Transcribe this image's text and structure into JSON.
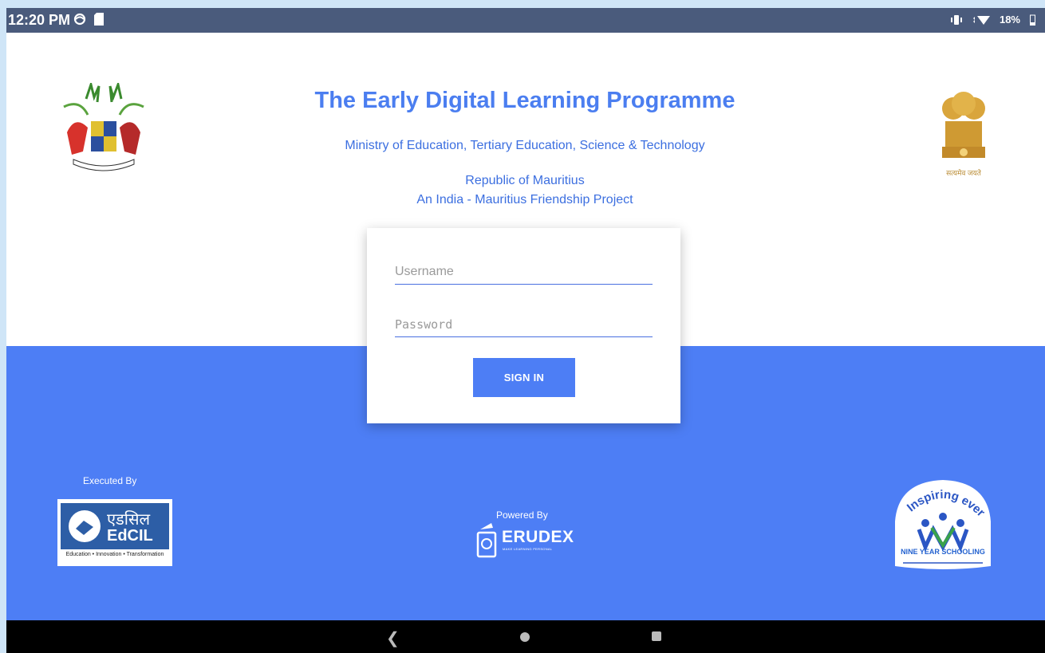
{
  "status_bar": {
    "time": "12:20 PM",
    "battery": "18%",
    "icons": [
      "sync-icon",
      "sd-card-icon",
      "vibrate-icon",
      "wifi-icon",
      "battery-icon"
    ]
  },
  "header": {
    "title": "The Early Digital Learning Programme",
    "ministry": "Ministry of Education, Tertiary Education, Science & Technology",
    "country": "Republic of Mauritius",
    "project": "An India - Mauritius Friendship Project",
    "india_motto": "सत्यमेव जयते"
  },
  "login": {
    "username_placeholder": "Username",
    "password_placeholder": "Password",
    "signin_label": "SIGN IN"
  },
  "footer": {
    "executed_label": "Executed By",
    "edcil_hindi": "एडसिल",
    "edcil_name": "EdCIL",
    "edcil_tagline": "Education • Innovation • Transformation",
    "powered_label": "Powered By",
    "erudex_name": "ERUDEX",
    "erudex_tagline": "MAKE LEARNING PERSONAL",
    "nys_arc_text": "Inspiring every child",
    "nys_name": "NINE YEAR SCHOOLING"
  },
  "colors": {
    "accent": "#4d7ef5",
    "title": "#4b7ef0",
    "status_bar": "#4a5b7c",
    "nav_bar": "#000000"
  }
}
